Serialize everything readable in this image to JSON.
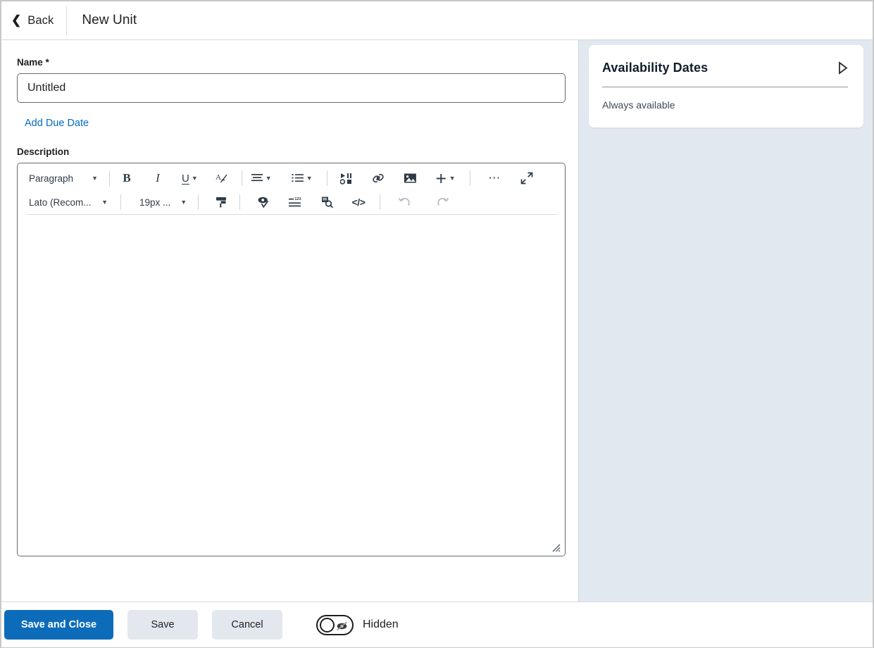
{
  "header": {
    "back_label": "Back",
    "title": "New Unit",
    "back_icon": "chevron-left-icon"
  },
  "form": {
    "name_label": "Name",
    "name_required_marker": "*",
    "name_value": "Untitled",
    "name_placeholder": "Untitled",
    "add_due_date_label": "Add Due Date",
    "description_label": "Description"
  },
  "editor": {
    "paragraph_style": "Paragraph",
    "font_family": "Lato (Recom...",
    "font_size": "19px ...",
    "tools_row1": [
      {
        "name": "bold-icon",
        "glyph": "B"
      },
      {
        "name": "italic-icon",
        "glyph": "I"
      },
      {
        "name": "underline-icon",
        "glyph": "U"
      },
      {
        "name": "clear-formatting-icon",
        "glyph": "A"
      },
      {
        "name": "align-icon",
        "glyph": "align"
      },
      {
        "name": "list-icon",
        "glyph": "list"
      },
      {
        "name": "insert-media-icon",
        "glyph": "media"
      },
      {
        "name": "insert-link-icon",
        "glyph": "link"
      },
      {
        "name": "insert-image-icon",
        "glyph": "image"
      },
      {
        "name": "insert-plus-icon",
        "glyph": "plus"
      },
      {
        "name": "more-options-icon",
        "glyph": "..."
      },
      {
        "name": "fullscreen-icon",
        "glyph": "expand"
      }
    ],
    "tools_row2": [
      {
        "name": "format-painter-icon",
        "glyph": "painter"
      },
      {
        "name": "accessibility-checker-icon",
        "glyph": "a11y"
      },
      {
        "name": "insert-numbering-icon",
        "glyph": "numbering"
      },
      {
        "name": "preview-icon",
        "glyph": "preview"
      },
      {
        "name": "html-source-icon",
        "glyph": "</>"
      },
      {
        "name": "undo-icon",
        "glyph": "undo"
      },
      {
        "name": "redo-icon",
        "glyph": "redo"
      }
    ],
    "body_text": ""
  },
  "availability": {
    "title": "Availability Dates",
    "expand_icon": "triangle-right-icon",
    "summary": "Always available"
  },
  "footer": {
    "save_and_close_label": "Save and Close",
    "save_label": "Save",
    "cancel_label": "Cancel",
    "visibility_label": "Hidden",
    "visibility_icon": "eye-hidden-icon",
    "visibility_state": "off"
  },
  "colors": {
    "primary": "#0d6cba",
    "link": "#056ac0",
    "panel_bg": "#e2e8ef",
    "secondary_btn": "#e3e8ee"
  }
}
